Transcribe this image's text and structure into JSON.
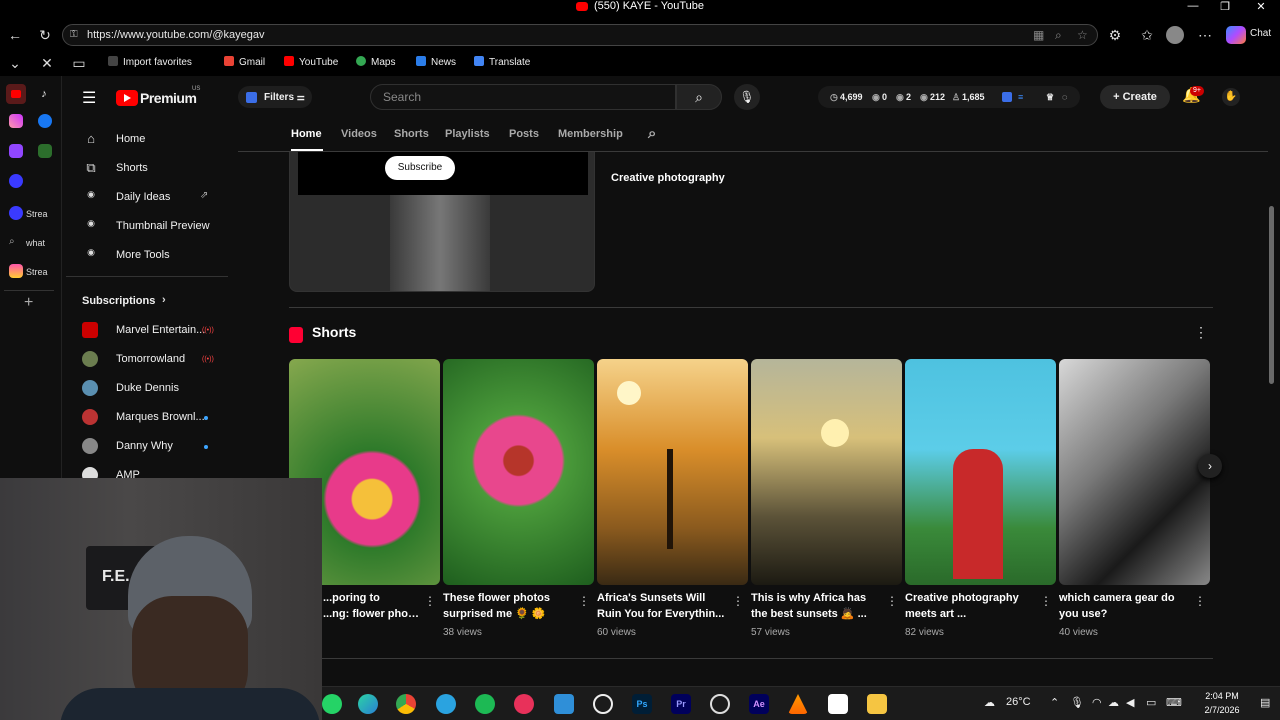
{
  "browser": {
    "window_title": "(550) KAYE - YouTube",
    "url": "https://www.youtube.com/@kayegav",
    "favorites": [
      "Import favorites",
      "Gmail",
      "YouTube",
      "Maps",
      "News",
      "Translate"
    ],
    "copilot_label": "Chat"
  },
  "edge_sidebar": {
    "items": [
      "Strea",
      "what",
      "Strea"
    ]
  },
  "youtube": {
    "logo": "Premium",
    "logo_region": "US",
    "filters_label": "Filters",
    "search_placeholder": "Search",
    "stats": {
      "s1": "4,699",
      "s2": "0",
      "s3": "2",
      "s4": "212",
      "s5": "1,685"
    },
    "create_label": "Create",
    "notifications_badge": "9+"
  },
  "sidebar": {
    "main_items": [
      {
        "label": "Home",
        "icon": "home-icon"
      },
      {
        "label": "Shorts",
        "icon": "shorts-icon"
      },
      {
        "label": "Daily Ideas",
        "icon": "tool-icon"
      },
      {
        "label": "Thumbnail Preview",
        "icon": "tool-icon"
      },
      {
        "label": "More Tools",
        "icon": "tool-icon"
      }
    ],
    "subscriptions_label": "Subscriptions",
    "subscriptions": [
      {
        "name": "Marvel Entertain...",
        "status": "live"
      },
      {
        "name": "Tomorrowland",
        "status": "live"
      },
      {
        "name": "Duke Dennis",
        "status": ""
      },
      {
        "name": "Marques Brownl...",
        "status": "new"
      },
      {
        "name": "Danny Why",
        "status": "new"
      },
      {
        "name": "AMP",
        "status": ""
      }
    ]
  },
  "channel_tabs": [
    "Home",
    "Videos",
    "Shorts",
    "Playlists",
    "Posts",
    "Membership"
  ],
  "video": {
    "subscribe_label": "Subscribe",
    "title": "Creative photography"
  },
  "shorts_section": {
    "title": "Shorts",
    "items": [
      {
        "title_line1": "...poring to",
        "title_line2": "...ng: flower photo...",
        "views": ""
      },
      {
        "title_line1": "These flower photos",
        "title_line2": "surprised me 🌻 🌼",
        "views": "38 views"
      },
      {
        "title_line1": "Africa's Sunsets Will",
        "title_line2": "Ruin You for Everythin...",
        "views": "60 views"
      },
      {
        "title_line1": "This is why Africa has",
        "title_line2": "the best sunsets 🙇 ...",
        "views": "57 views"
      },
      {
        "title_line1": "Creative photography",
        "title_line2": "meets art ...",
        "views": "82 views"
      },
      {
        "title_line1": "which camera gear do",
        "title_line2": "you use?",
        "views": "40 views"
      }
    ]
  },
  "webcam": {
    "cap_text": "F.E."
  },
  "taskbar": {
    "temperature": "26°C",
    "time": "2:04 PM",
    "date": "2/7/2026"
  }
}
